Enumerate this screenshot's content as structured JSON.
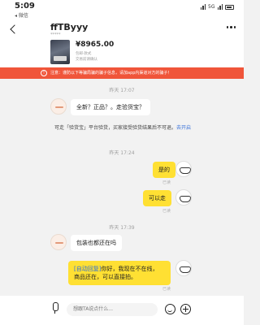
{
  "status_bar": {
    "time": "5:09",
    "carrier_sub": "◂ 微信",
    "network": "5G"
  },
  "header": {
    "title": "ffTByyy",
    "subtitle": "*****"
  },
  "product": {
    "price": "¥8965.00",
    "line1": "包邮·款式",
    "line2": "交易前请确认"
  },
  "notice": {
    "text": "注意：谨防以下等骗局骗的骗子信息，请加app内渠道对方的骗子！"
  },
  "chat": {
    "time1": "昨天 17:07",
    "msg1": "全新？正品？。走验货宝？",
    "sys_msg": "可走「验货宝」平台验货，买家接受验货结果后不可退。",
    "sys_link": "去开启",
    "time2": "昨天 17:24",
    "msg2": "是的",
    "read1": "已读",
    "msg3": "可以走",
    "read2": "已读",
    "time3": "昨天 17:39",
    "msg4": "包装也都还在吗",
    "auto_tag": "[自动回复]",
    "msg5_line1": "你好，我现在不在线，",
    "msg5_line2": "商品还在，可以直接拍。",
    "read3": "已读"
  },
  "input": {
    "placeholder": "想跟TA说点什么..."
  }
}
